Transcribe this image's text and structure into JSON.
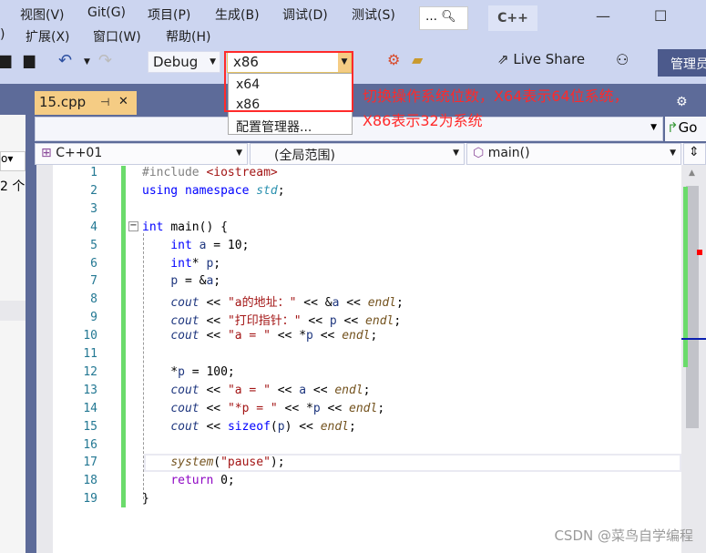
{
  "menu": {
    "row1": [
      "视图(V)",
      "Git(G)",
      "项目(P)",
      "生成(B)",
      "调试(D)",
      "测试(S)"
    ],
    "row2": [
      ")",
      "扩展(X)",
      "窗口(W)",
      "帮助(H)"
    ],
    "search_label": "…",
    "search_icon": "search-icon",
    "lang_badge": "C++"
  },
  "toolbar": {
    "configuration": "Debug",
    "platform": "x86",
    "live_share": "Live Share",
    "admin": "管理员"
  },
  "platform_dropdown": {
    "options": [
      "x64",
      "x86"
    ],
    "manager": "配置管理器..."
  },
  "annotation": {
    "line1": "切换操作系统位数，X64表示64位系统，",
    "line2": "X86表示32为系统"
  },
  "tab": {
    "label": "15.cpp",
    "pin": "⊣",
    "close": "✕"
  },
  "left_panel": {
    "text": "2 个"
  },
  "nav": {
    "go": "Go",
    "project": "C++01",
    "scope": "(全局范围)",
    "member": "main()"
  },
  "code": [
    [
      [
        "#include ",
        "inc"
      ],
      [
        "<iostream>",
        "ang"
      ]
    ],
    [
      [
        "using namespace ",
        "kw"
      ],
      [
        "std",
        "ns"
      ],
      [
        ";",
        ""
      ]
    ],
    [],
    [
      [
        "int ",
        "kw"
      ],
      [
        "main() {",
        ""
      ]
    ],
    [
      [
        "    int ",
        "kw"
      ],
      [
        "a",
        "var"
      ],
      [
        " = 10;",
        ""
      ]
    ],
    [
      [
        "    int",
        "kw"
      ],
      [
        "* ",
        ""
      ],
      [
        "p",
        "var"
      ],
      [
        ";",
        ""
      ]
    ],
    [
      [
        "    ",
        ""
      ],
      [
        "p",
        "var"
      ],
      [
        " = &",
        ""
      ],
      [
        "a",
        "var"
      ],
      [
        ";",
        ""
      ]
    ],
    [
      [
        "    ",
        ""
      ],
      [
        "cout",
        "obj"
      ],
      [
        " << ",
        ""
      ],
      [
        "\"a的地址：\"",
        "str"
      ],
      [
        " << &",
        ""
      ],
      [
        "a",
        "var"
      ],
      [
        " << ",
        ""
      ],
      [
        "endl",
        "fn"
      ],
      [
        ";",
        ""
      ]
    ],
    [
      [
        "    ",
        ""
      ],
      [
        "cout",
        "obj"
      ],
      [
        " << ",
        ""
      ],
      [
        "\"打印指针：\"",
        "str"
      ],
      [
        " << ",
        ""
      ],
      [
        "p",
        "var"
      ],
      [
        " << ",
        ""
      ],
      [
        "endl",
        "fn"
      ],
      [
        ";",
        ""
      ]
    ],
    [
      [
        "    ",
        ""
      ],
      [
        "cout",
        "obj"
      ],
      [
        " << ",
        ""
      ],
      [
        "\"a = \"",
        "str"
      ],
      [
        " << *",
        ""
      ],
      [
        "p",
        "var"
      ],
      [
        " << ",
        ""
      ],
      [
        "endl",
        "fn"
      ],
      [
        ";",
        ""
      ]
    ],
    [],
    [
      [
        "    *",
        ""
      ],
      [
        "p",
        "var"
      ],
      [
        " = 100;",
        ""
      ]
    ],
    [
      [
        "    ",
        ""
      ],
      [
        "cout",
        "obj"
      ],
      [
        " << ",
        ""
      ],
      [
        "\"a = \"",
        "str"
      ],
      [
        " << ",
        ""
      ],
      [
        "a",
        "var"
      ],
      [
        " << ",
        ""
      ],
      [
        "endl",
        "fn"
      ],
      [
        ";",
        ""
      ]
    ],
    [
      [
        "    ",
        ""
      ],
      [
        "cout",
        "obj"
      ],
      [
        " << ",
        ""
      ],
      [
        "\"*p = \"",
        "str"
      ],
      [
        " << *",
        ""
      ],
      [
        "p",
        "var"
      ],
      [
        " << ",
        ""
      ],
      [
        "endl",
        "fn"
      ],
      [
        ";",
        ""
      ]
    ],
    [
      [
        "    ",
        ""
      ],
      [
        "cout",
        "obj"
      ],
      [
        " << ",
        ""
      ],
      [
        "sizeof",
        "kw"
      ],
      [
        "(",
        ""
      ],
      [
        "p",
        "var"
      ],
      [
        ") << ",
        ""
      ],
      [
        "endl",
        "fn"
      ],
      [
        ";",
        ""
      ]
    ],
    [],
    [
      [
        "    ",
        ""
      ],
      [
        "system",
        "fn"
      ],
      [
        "(",
        ""
      ],
      [
        "\"pause\"",
        "str"
      ],
      [
        ");",
        ""
      ]
    ],
    [
      [
        "    ",
        ""
      ],
      [
        "return ",
        "ret"
      ],
      [
        "0;",
        ""
      ]
    ],
    [
      [
        "}",
        ""
      ]
    ]
  ],
  "watermark": "CSDN @菜鸟自学编程",
  "colors": {
    "accent_tab": "#f5cc84",
    "annotation": "#ff2a2a",
    "chrome": "#5d6b99",
    "changed_lines": "#6bdb6b"
  }
}
